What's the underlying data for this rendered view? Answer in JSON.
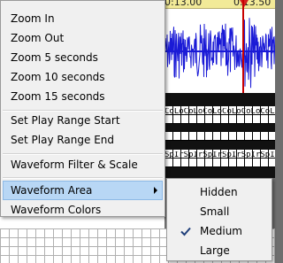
{
  "timeline": {
    "time_left": "0:13.00",
    "time_right": "0:13.50"
  },
  "lyrics": {
    "row1": "CoLoCoLoCoLoCoLoCoLoCoLo",
    "row2": "SpIrSpIrSpIrSpIrSpIrSpIr"
  },
  "context_menu": {
    "zoom_in": "Zoom In",
    "zoom_out": "Zoom Out",
    "zoom_5": "Zoom 5 seconds",
    "zoom_10": "Zoom 10 seconds",
    "zoom_15": "Zoom 15 seconds",
    "set_play_range_start": "Set Play Range Start",
    "set_play_range_end": "Set Play Range End",
    "waveform_filter_scale": "Waveform Filter & Scale",
    "waveform_area": "Waveform Area",
    "waveform_colors": "Waveform Colors"
  },
  "waveform_area_submenu": {
    "items": [
      "Hidden",
      "Small",
      "Medium",
      "Large"
    ],
    "checked": "Medium"
  },
  "colors": {
    "waveform": "#1a1ad6",
    "menu_background": "#f0f0f0",
    "menu_highlight": "#b8d7f5",
    "timeline_bar": "#f2ea98",
    "playhead": "#d32020"
  }
}
